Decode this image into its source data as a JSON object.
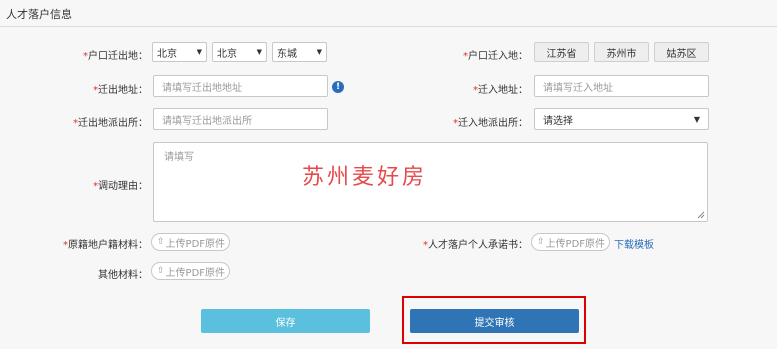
{
  "section_title": "人才落户信息",
  "form": {
    "origin": {
      "label": "户口迁出地：",
      "province": "北京",
      "city": "北京",
      "district": "东城"
    },
    "dest": {
      "label": "户口迁入地：",
      "chips": [
        "江苏省",
        "苏州市",
        "姑苏区"
      ]
    },
    "out_address": {
      "label": "迁出地址：",
      "placeholder": "请填写迁出地地址"
    },
    "in_address": {
      "label": "迁入地址：",
      "placeholder": "请填写迁入地址"
    },
    "out_police": {
      "label": "迁出地派出所：",
      "placeholder": "请填写迁出地派出所"
    },
    "in_police": {
      "label": "迁入地派出所：",
      "value": "请选择"
    },
    "reason": {
      "label": "调动理由：",
      "placeholder": "请填写"
    },
    "original_docs": {
      "label": "原籍地户籍材料：",
      "button": "上传PDF原件"
    },
    "commitment": {
      "label": "人才落户个人承诺书：",
      "button": "上传PDF原件",
      "link": "下载模板"
    },
    "other_docs": {
      "label": "其他材料：",
      "button": "上传PDF原件"
    }
  },
  "watermark": "苏州麦好房",
  "buttons": {
    "save": "保存",
    "submit": "提交审核"
  },
  "colors": {
    "save": "#5bc0de",
    "submit": "#2f74b5",
    "required": "#e03030",
    "highlight": "#e00000"
  }
}
